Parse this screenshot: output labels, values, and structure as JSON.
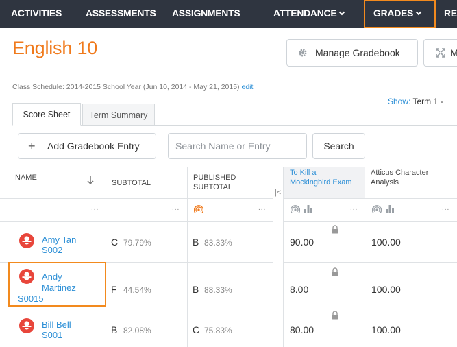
{
  "nav": {
    "items": [
      {
        "label": "ACTIVITIES",
        "has_dropdown": false
      },
      {
        "label": "ASSESSMENTS",
        "has_dropdown": false
      },
      {
        "label": "ASSIGNMENTS",
        "has_dropdown": false
      },
      {
        "label": "ATTENDANCE",
        "has_dropdown": true
      },
      {
        "label": "GRADES",
        "has_dropdown": true,
        "active": true
      },
      {
        "label": "RE",
        "has_dropdown": false
      }
    ]
  },
  "header": {
    "title": "English 10",
    "manage_button": "Manage Gradebook",
    "expand_button": "M"
  },
  "schedule": {
    "text": "Class Schedule: 2014-2015 School Year (Jun 10, 2014 - May 21, 2015)",
    "edit_link": "edit",
    "show_label": "Show:",
    "show_value": "Term 1 -"
  },
  "tabs": [
    {
      "label": "Score Sheet",
      "active": true
    },
    {
      "label": "Term Summary",
      "active": false
    }
  ],
  "toolbar": {
    "add_label": "Add Gradebook Entry",
    "search_placeholder": "Search Name or Entry",
    "search_button": "Search"
  },
  "grid": {
    "headers": {
      "name": "NAME",
      "subtotal": "SUBTOTAL",
      "published_line1": "PUBLISHED",
      "published_line2": "SUBTOTAL",
      "exam_line1": "To Kill a",
      "exam_line2": "Mockingbird Exam",
      "analysis_line1": "Atticus Character",
      "analysis_line2": "Analysis"
    },
    "dots": "...",
    "rows": [
      {
        "name_line1": "Amy Tan",
        "name_line2": "S002",
        "name_line3": "",
        "subtotal_letter": "C",
        "subtotal_pct": "79.79%",
        "published_letter": "B",
        "published_pct": "83.33%",
        "exam_score": "90.00",
        "analysis_score": "100.00"
      },
      {
        "name_line1": "Andy",
        "name_line2": "Martinez",
        "name_line3": "S0015",
        "subtotal_letter": "F",
        "subtotal_pct": "44.54%",
        "published_letter": "B",
        "published_pct": "88.33%",
        "exam_score": "8.00",
        "analysis_score": "100.00"
      },
      {
        "name_line1": "Bill Bell",
        "name_line2": "S001",
        "name_line3": "",
        "subtotal_letter": "B",
        "subtotal_pct": "82.08%",
        "published_letter": "C",
        "published_pct": "75.83%",
        "exam_score": "80.00",
        "analysis_score": "100.00"
      }
    ]
  },
  "colors": {
    "nav_bg": "#2f3540",
    "accent_orange": "#f07a1c",
    "highlight_border": "#f28a1e",
    "link_blue": "#2c8fd6",
    "avatar_red": "#e8463b"
  }
}
